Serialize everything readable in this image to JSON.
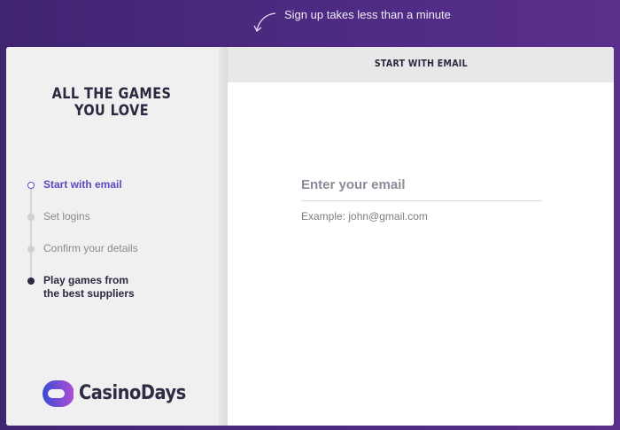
{
  "hint": {
    "text": "Sign up takes less than a minute",
    "icon": "curved-arrow-icon"
  },
  "sidebar": {
    "headline_line1": "ALL THE GAMES",
    "headline_line2": "YOU LOVE",
    "steps": [
      {
        "label": "Start with email",
        "state": "active"
      },
      {
        "label": "Set logins",
        "state": "pending"
      },
      {
        "label": "Confirm your details",
        "state": "pending"
      },
      {
        "label_line1": "Play games from",
        "label_line2": "the best suppliers",
        "state": "final"
      }
    ],
    "logo_text": "CasinoDays"
  },
  "form": {
    "tab_label": "START WITH EMAIL",
    "email_placeholder": "Enter your email",
    "email_value": "",
    "example_text": "Example: john@gmail.com"
  },
  "colors": {
    "background": "#4c2a82",
    "accent": "#5a4bc2",
    "text_dark": "#2a2940",
    "logo_gradient_start": "#3b4bd1",
    "logo_gradient_end": "#b04fd6"
  }
}
